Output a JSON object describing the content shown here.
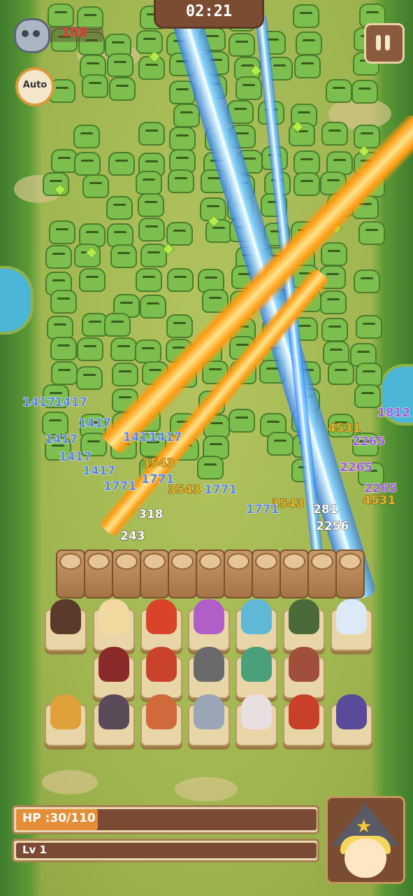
{
  "hud": {
    "timer": "02:21",
    "kill_count": "108",
    "auto_label": "Auto",
    "pause_label": "Pause",
    "hp_label": "HP :30/110",
    "hp_current": 30,
    "hp_max": 110,
    "level_label": "Lv 1"
  },
  "icons": {
    "skull": "skull-icon",
    "pause": "pause-icon",
    "auto": "auto-cycle-icon",
    "portrait": "witch-portrait-icon"
  },
  "damage_numbers": [
    "1417",
    "1417",
    "1417",
    "1417",
    "1417",
    "1417",
    "1417",
    "1417",
    "3543",
    "3543",
    "3543",
    "1771",
    "1771",
    "1771",
    "1771",
    "4531",
    "4531",
    "2265",
    "2265",
    "2265",
    "1812",
    "318",
    "281",
    "2256",
    "243"
  ],
  "colors": {
    "hp_bar": "#e48e38",
    "bar_bg": "#7b4a34",
    "kill_text": "#e23a3a"
  }
}
